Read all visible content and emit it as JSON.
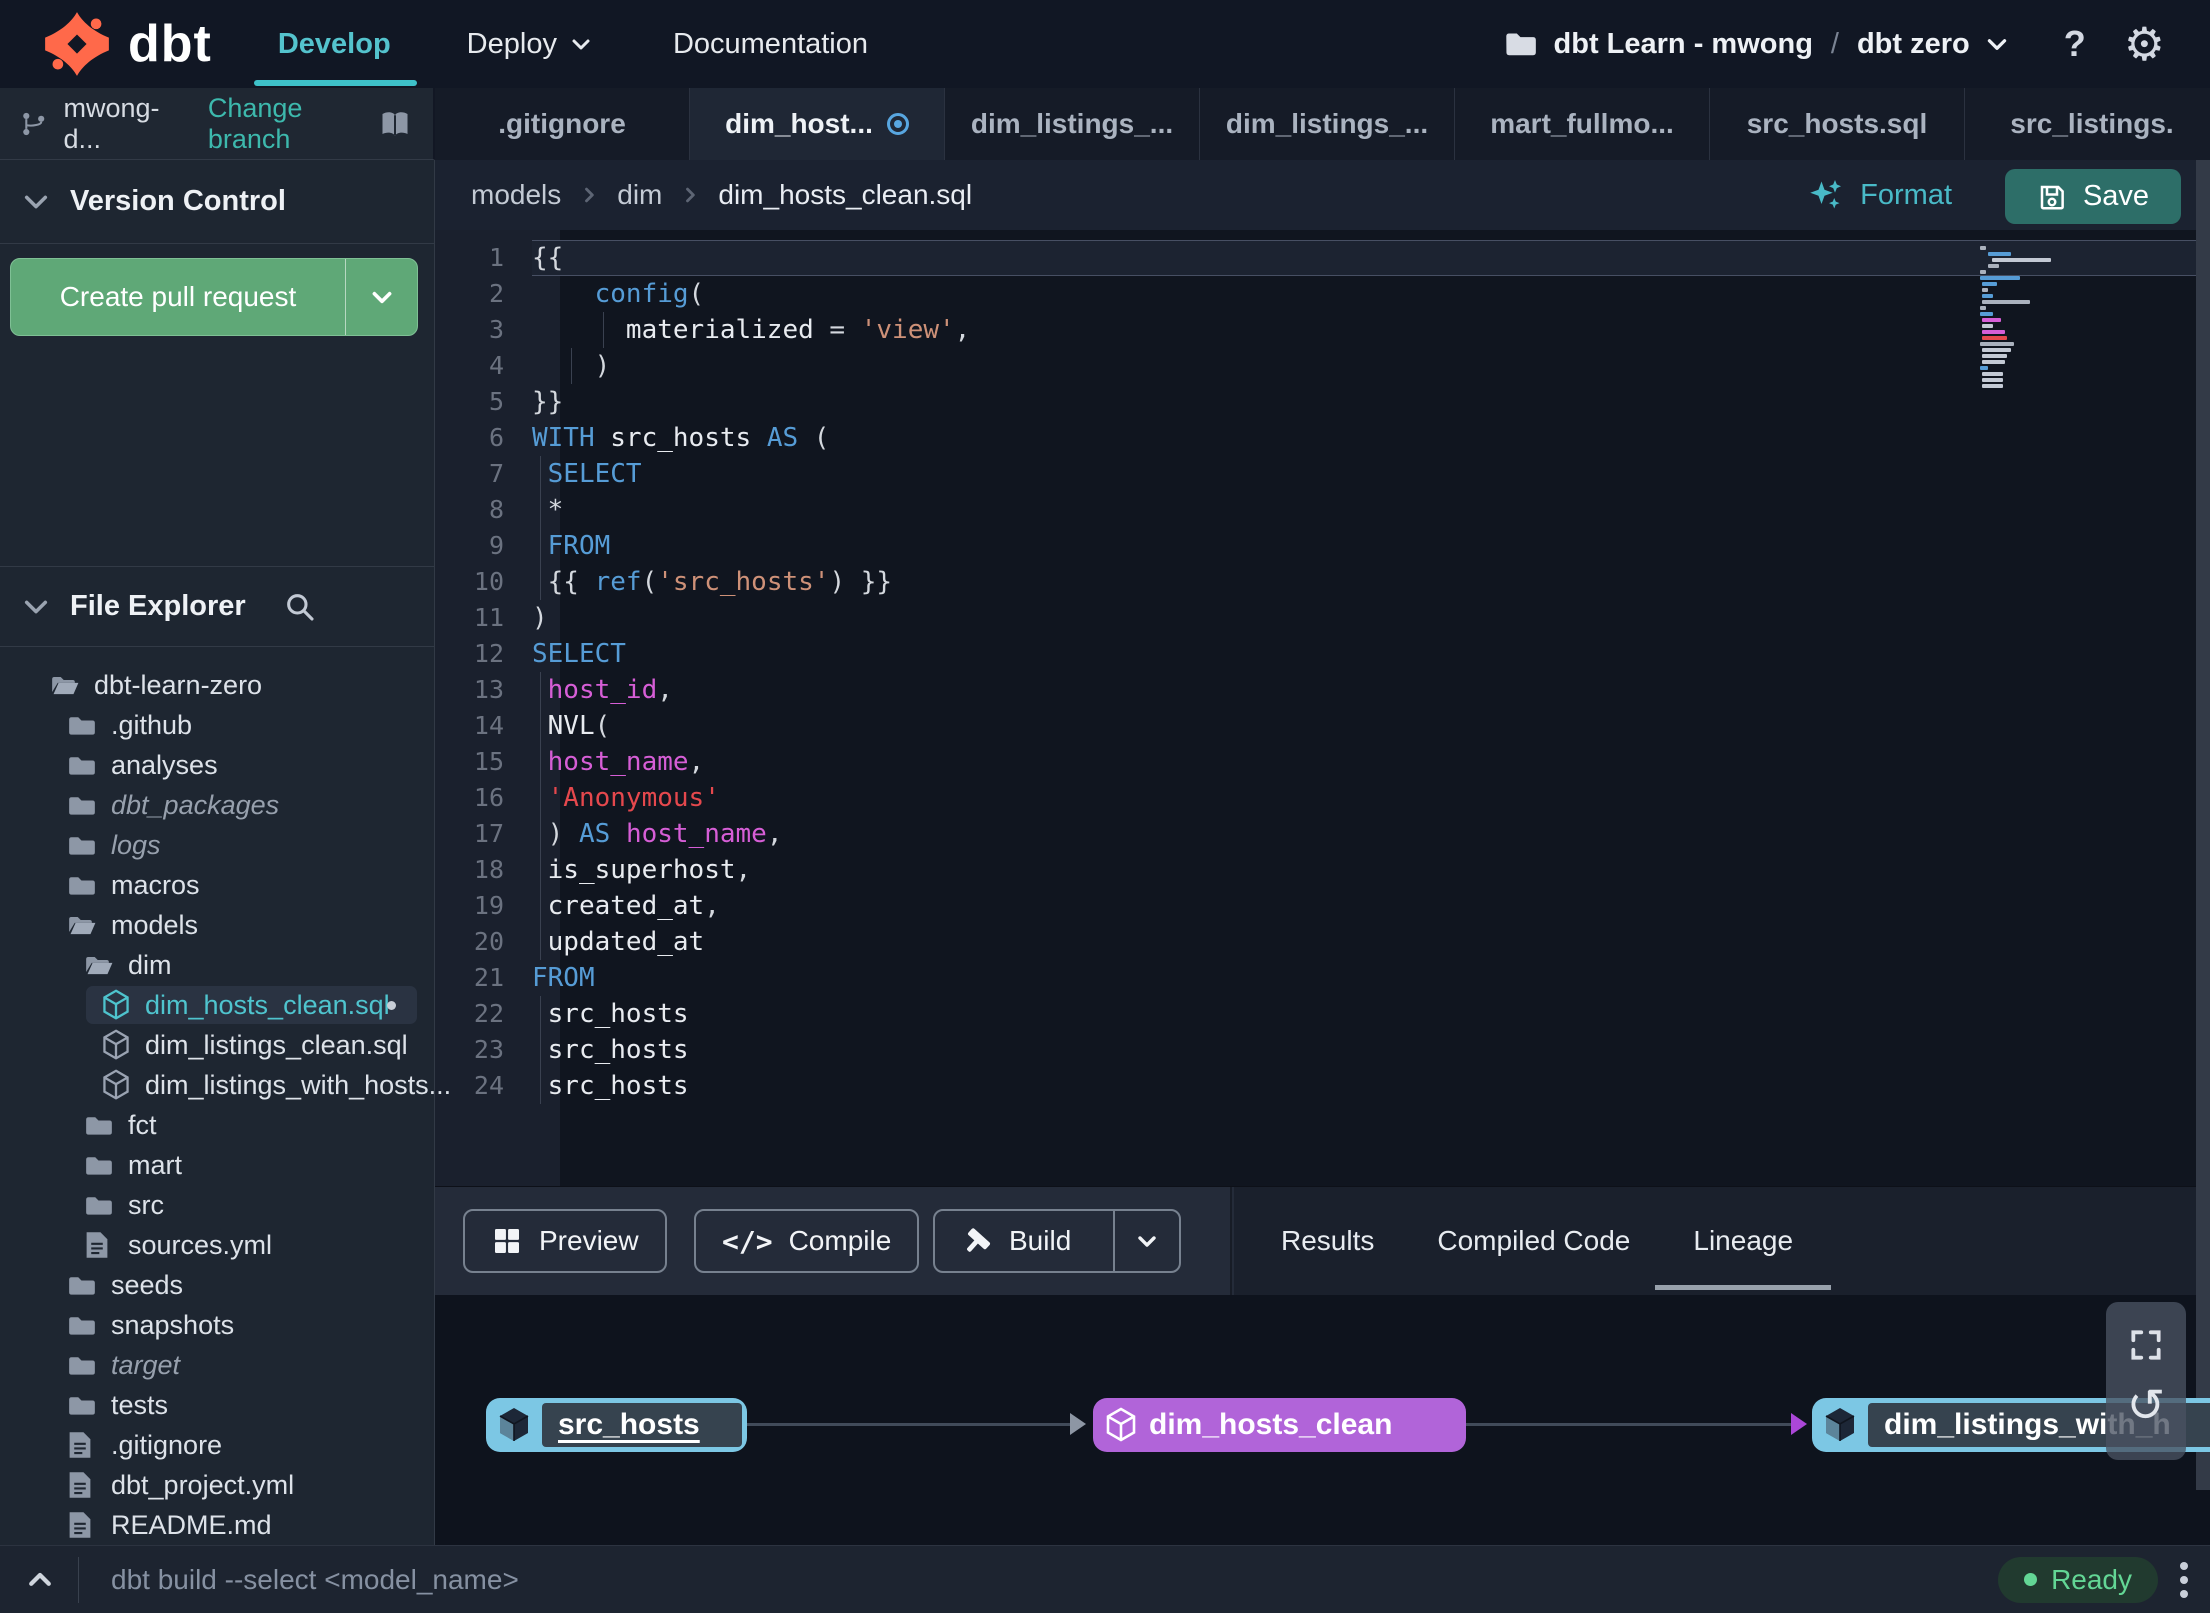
{
  "nav": {
    "brand": "dbt",
    "develop": "Develop",
    "deploy": "Deploy",
    "documentation": "Documentation",
    "project": "dbt Learn - mwong",
    "separator": "/",
    "environment": "dbt zero",
    "help_label": "?"
  },
  "branch": {
    "name": "mwong-d...",
    "change_branch": "Change branch"
  },
  "version_control": {
    "title": "Version Control",
    "create_pr": "Create pull request"
  },
  "file_explorer": {
    "title": "File Explorer",
    "items": [
      {
        "label": "dbt-learn-zero",
        "depth": 0,
        "type": "folder-open"
      },
      {
        "label": ".github",
        "depth": 1,
        "type": "folder"
      },
      {
        "label": "analyses",
        "depth": 1,
        "type": "folder"
      },
      {
        "label": "dbt_packages",
        "depth": 1,
        "type": "folder",
        "italic": true
      },
      {
        "label": "logs",
        "depth": 1,
        "type": "folder",
        "italic": true
      },
      {
        "label": "macros",
        "depth": 1,
        "type": "folder"
      },
      {
        "label": "models",
        "depth": 1,
        "type": "folder-open"
      },
      {
        "label": "dim",
        "depth": 2,
        "type": "folder-open"
      },
      {
        "label": "dim_hosts_clean.sql",
        "depth": 3,
        "type": "model",
        "selected": true,
        "modified": true
      },
      {
        "label": "dim_listings_clean.sql",
        "depth": 3,
        "type": "model"
      },
      {
        "label": "dim_listings_with_hosts...",
        "depth": 3,
        "type": "model"
      },
      {
        "label": "fct",
        "depth": 2,
        "type": "folder"
      },
      {
        "label": "mart",
        "depth": 2,
        "type": "folder"
      },
      {
        "label": "src",
        "depth": 2,
        "type": "folder"
      },
      {
        "label": "sources.yml",
        "depth": 2,
        "type": "file"
      },
      {
        "label": "seeds",
        "depth": 1,
        "type": "folder"
      },
      {
        "label": "snapshots",
        "depth": 1,
        "type": "folder"
      },
      {
        "label": "target",
        "depth": 1,
        "type": "folder",
        "italic": true
      },
      {
        "label": "tests",
        "depth": 1,
        "type": "folder"
      },
      {
        "label": ".gitignore",
        "depth": 1,
        "type": "file"
      },
      {
        "label": "dbt_project.yml",
        "depth": 1,
        "type": "file"
      },
      {
        "label": "README.md",
        "depth": 1,
        "type": "file"
      }
    ]
  },
  "tabs": [
    {
      "label": ".gitignore"
    },
    {
      "label": "dim_host...",
      "active": true,
      "modified": true
    },
    {
      "label": "dim_listings_..."
    },
    {
      "label": "dim_listings_..."
    },
    {
      "label": "mart_fullmo..."
    },
    {
      "label": "src_hosts.sql"
    },
    {
      "label": "src_listings."
    }
  ],
  "new_tab": "+",
  "breadcrumb": {
    "items": [
      "models",
      "dim",
      "dim_hosts_clean.sql"
    ]
  },
  "toolbar": {
    "format": "Format",
    "save": "Save"
  },
  "editor": {
    "syntax_colors": {
      "keyword": "#569cd6",
      "string": "#ce9178",
      "column": "#d65ed6",
      "string_red": "#e5484d",
      "identifier": "#e8ebf0",
      "punct": "#d4d8de"
    },
    "lines": [
      {
        "n": 1,
        "cur": true,
        "tokens": [
          {
            "t": "{{",
            "c": "p"
          }
        ]
      },
      {
        "n": 2,
        "tokens": [
          {
            "t": "    "
          },
          {
            "t": "config",
            "c": "k"
          },
          {
            "t": "(",
            "c": "p"
          }
        ]
      },
      {
        "n": 3,
        "guides": [
          4
        ],
        "tokens": [
          {
            "t": "      "
          },
          {
            "t": "materialized",
            "c": "n"
          },
          {
            "t": " = ",
            "c": "p"
          },
          {
            "t": "'view'",
            "c": "s"
          },
          {
            "t": ",",
            "c": "p"
          }
        ]
      },
      {
        "n": 4,
        "guides": [
          2
        ],
        "tokens": [
          {
            "t": "    "
          },
          {
            "t": ")",
            "c": "p"
          }
        ]
      },
      {
        "n": 5,
        "tokens": [
          {
            "t": "}}",
            "c": "p"
          }
        ]
      },
      {
        "n": 6,
        "tokens": [
          {
            "t": "WITH",
            "c": "k"
          },
          {
            "t": " "
          },
          {
            "t": "src_hosts",
            "c": "n"
          },
          {
            "t": " "
          },
          {
            "t": "AS",
            "c": "k"
          },
          {
            "t": " (",
            "c": "p"
          }
        ]
      },
      {
        "n": 7,
        "guides": [
          0
        ],
        "tokens": [
          {
            "t": " "
          },
          {
            "t": "SELECT",
            "c": "k"
          }
        ]
      },
      {
        "n": 8,
        "guides": [
          0
        ],
        "tokens": [
          {
            "t": " "
          },
          {
            "t": "*",
            "c": "p"
          }
        ]
      },
      {
        "n": 9,
        "guides": [
          0
        ],
        "tokens": [
          {
            "t": " "
          },
          {
            "t": "FROM",
            "c": "k"
          }
        ]
      },
      {
        "n": 10,
        "guides": [
          0
        ],
        "tokens": [
          {
            "t": " "
          },
          {
            "t": "{{ ",
            "c": "p"
          },
          {
            "t": "ref",
            "c": "k"
          },
          {
            "t": "(",
            "c": "p"
          },
          {
            "t": "'src_hosts'",
            "c": "s"
          },
          {
            "t": ") }}",
            "c": "p"
          }
        ]
      },
      {
        "n": 11,
        "tokens": [
          {
            "t": ")",
            "c": "p"
          }
        ]
      },
      {
        "n": 12,
        "tokens": [
          {
            "t": "SELECT",
            "c": "k"
          }
        ]
      },
      {
        "n": 13,
        "guides": [
          0
        ],
        "tokens": [
          {
            "t": " "
          },
          {
            "t": "host_id",
            "c": "col"
          },
          {
            "t": ",",
            "c": "p"
          }
        ]
      },
      {
        "n": 14,
        "guides": [
          0
        ],
        "tokens": [
          {
            "t": " "
          },
          {
            "t": "NVL",
            "c": "n"
          },
          {
            "t": "(",
            "c": "p"
          }
        ]
      },
      {
        "n": 15,
        "guides": [
          0
        ],
        "tokens": [
          {
            "t": " "
          },
          {
            "t": "host_name",
            "c": "col"
          },
          {
            "t": ",",
            "c": "p"
          }
        ]
      },
      {
        "n": 16,
        "guides": [
          0
        ],
        "tokens": [
          {
            "t": " "
          },
          {
            "t": "'Anonymous'",
            "c": "r"
          }
        ]
      },
      {
        "n": 17,
        "guides": [
          0
        ],
        "tokens": [
          {
            "t": " ) ",
            "c": "p"
          },
          {
            "t": "AS",
            "c": "k"
          },
          {
            "t": " "
          },
          {
            "t": "host_name",
            "c": "col"
          },
          {
            "t": ",",
            "c": "p"
          }
        ]
      },
      {
        "n": 18,
        "guides": [
          0
        ],
        "tokens": [
          {
            "t": " "
          },
          {
            "t": "is_superhost",
            "c": "n"
          },
          {
            "t": ",",
            "c": "p"
          }
        ]
      },
      {
        "n": 19,
        "guides": [
          0
        ],
        "tokens": [
          {
            "t": " "
          },
          {
            "t": "created_at",
            "c": "n"
          },
          {
            "t": ",",
            "c": "p"
          }
        ]
      },
      {
        "n": 20,
        "guides": [
          0
        ],
        "tokens": [
          {
            "t": " "
          },
          {
            "t": "updated_at",
            "c": "n"
          }
        ]
      },
      {
        "n": 21,
        "tokens": [
          {
            "t": "FROM",
            "c": "k"
          }
        ]
      },
      {
        "n": 22,
        "guides": [
          0
        ],
        "tokens": [
          {
            "t": " "
          },
          {
            "t": "src_hosts",
            "c": "n"
          }
        ]
      },
      {
        "n": 23,
        "guides": [
          0
        ],
        "tokens": [
          {
            "t": " "
          },
          {
            "t": "src_hosts",
            "c": "n"
          }
        ]
      },
      {
        "n": 24,
        "guides": [
          0
        ],
        "tokens": [
          {
            "t": " "
          },
          {
            "t": "src_hosts",
            "c": "n"
          }
        ]
      }
    ]
  },
  "action_bar": {
    "preview": "Preview",
    "compile": "Compile",
    "build": "Build",
    "tabs": [
      {
        "label": "Results"
      },
      {
        "label": "Compiled Code"
      },
      {
        "label": "Lineage",
        "active": true
      }
    ]
  },
  "lineage": {
    "nodes": [
      {
        "label": "src_hosts",
        "color": "blue",
        "hovered": true
      },
      {
        "label": "dim_hosts_clean",
        "color": "purple"
      },
      {
        "label": "dim_listings_with_h",
        "color": "blue"
      }
    ]
  },
  "status_bar": {
    "command": "dbt build --select <model_name>",
    "status": "Ready"
  },
  "colors": {
    "accent_teal": "#45bdc5",
    "create_pr_green": "#5fa877",
    "save_teal": "#2d6e68",
    "node_blue": "#7cc7e4",
    "node_purple": "#b164d9",
    "ready_green": "#63d695",
    "modified_blue": "#58a6e0",
    "logo_orange": "#ff694a"
  }
}
